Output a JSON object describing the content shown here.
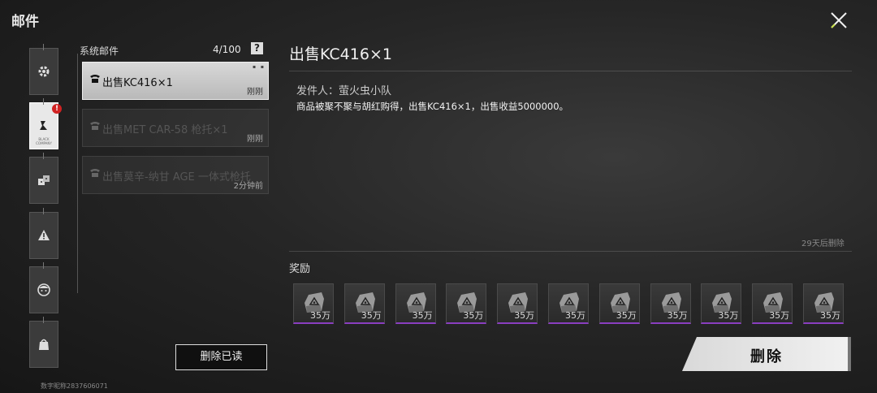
{
  "header": {
    "title": "邮件"
  },
  "categories": [
    {
      "icon": "gear-icon"
    },
    {
      "icon": "letter-icon",
      "badge": "!",
      "caption": "BLACK COMPANY"
    },
    {
      "icon": "dice-icon"
    },
    {
      "icon": "warning-icon"
    },
    {
      "icon": "girl-icon"
    },
    {
      "icon": "bag-icon"
    }
  ],
  "mail_list": {
    "label": "系统邮件",
    "count": "4/100",
    "help": "?",
    "items": [
      {
        "subject": "出售KC416×1",
        "time": "刚刚"
      },
      {
        "subject": "出售MET CAR-58 枪托×1",
        "time": "刚刚"
      },
      {
        "subject": "出售莫辛-纳甘 AGE 一体式枪托",
        "time": "2分钟前"
      }
    ]
  },
  "detail": {
    "title": "出售KC416×1",
    "sender": "发件人：萤火虫小队",
    "body": "商品被聚不聚与胡红购得，出售KC416×1，出售收益5000000。",
    "expire": "29天后删除",
    "reward_label": "奖励",
    "rewards": [
      "35万",
      "35万",
      "35万",
      "35万",
      "35万",
      "35万",
      "35万",
      "35万",
      "35万",
      "35万",
      "35万"
    ]
  },
  "buttons": {
    "delete_read": "删除已读",
    "delete": "删除"
  },
  "footer": {
    "uid": "数字昵称2837606071"
  },
  "colors": {
    "rarity": "#8a3ec0",
    "badge": "#d12222",
    "close_accent": "#c8e04a"
  }
}
